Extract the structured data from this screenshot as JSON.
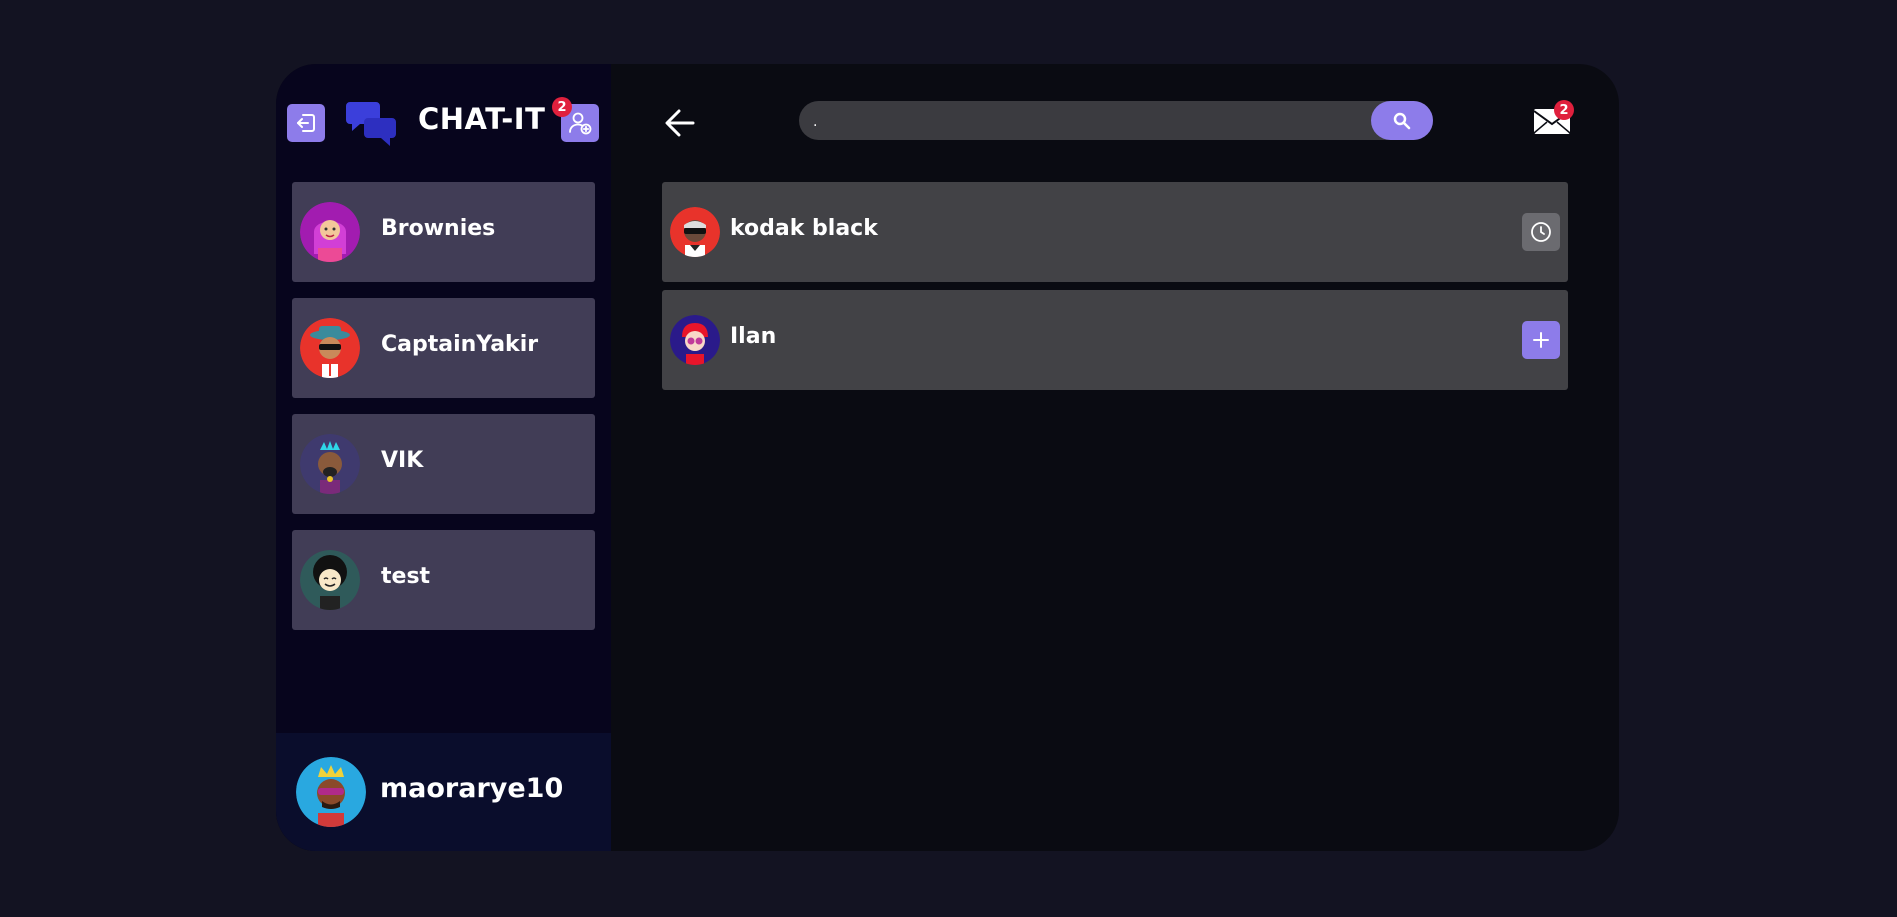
{
  "app": {
    "title": "CHAT-IT"
  },
  "header": {
    "friend_requests_count": "2"
  },
  "chats": [
    {
      "name": "Brownies"
    },
    {
      "name": "CaptainYakir"
    },
    {
      "name": "VIK"
    },
    {
      "name": "test"
    }
  ],
  "profile": {
    "username": "maorarye10"
  },
  "search": {
    "value": "."
  },
  "inbox": {
    "count": "2"
  },
  "results": [
    {
      "name": "kodak black",
      "action": "pending"
    },
    {
      "name": "Ilan",
      "action": "add"
    }
  ],
  "colors": {
    "accent": "#8d7cea",
    "sidebar": "#07051d",
    "card": "#413d56",
    "badge": "#e0203d"
  }
}
